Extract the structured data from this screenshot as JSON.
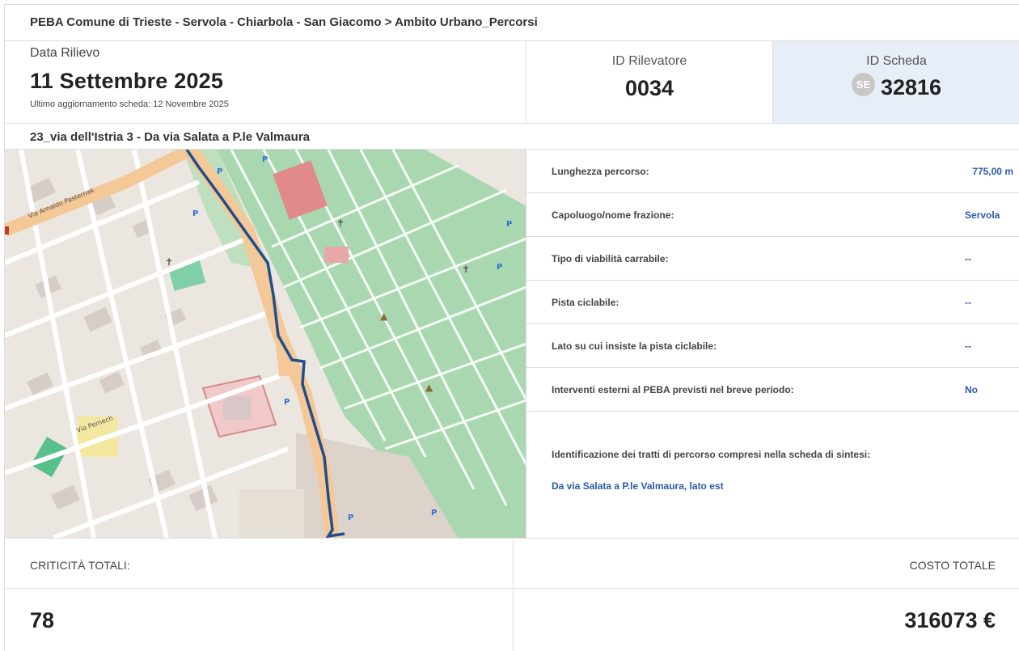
{
  "header": {
    "title": "PEBA Comune di Trieste - Servola - Chiarbola - San Giacomo > Ambito Urbano_Percorsi"
  },
  "survey": {
    "date_label": "Data Rilievo",
    "date_value": "11 Settembre 2025",
    "updated": "Ultimo aggiornamento scheda: 12 Novembre 2025",
    "rilevatore_label": "ID Rilevatore",
    "rilevatore_value": "0034",
    "scheda_label": "ID Scheda",
    "scheda_badge": "SE",
    "scheda_value": "32816"
  },
  "route": {
    "name": "23_via dell'Istria 3 - Da via Salata a P.le Valmaura"
  },
  "map": {
    "street_label": "Via Arnaldo Pasternak",
    "street_label_2": "Via Pernech"
  },
  "details": [
    {
      "label": "Lunghezza percorso:",
      "value": "775,00 m"
    },
    {
      "label": "Capoluogo/nome frazione:",
      "value": "Servola"
    },
    {
      "label": "Tipo di viabilità carrabile:",
      "value": "--"
    },
    {
      "label": "Pista ciclabile:",
      "value": "--"
    },
    {
      "label": "Lato su cui insiste la pista ciclabile:",
      "value": "--"
    },
    {
      "label": "Interventi esterni al PEBA previsti nel breve periodo:",
      "value": "No"
    }
  ],
  "identification": {
    "label": "Identificazione dei tratti di percorso compresi nella scheda di sintesi:",
    "value": "Da via Salata a P.le Valmaura, lato est"
  },
  "totals": {
    "criticita_label": "CRITICITÀ TOTALI:",
    "criticita_value": "78",
    "costo_label": "COSTO TOTALE",
    "costo_value": "316073 €"
  },
  "colors": {
    "route_line": "#1f4e8c",
    "link_text": "#2a5aa8",
    "scheda_bg": "#e8eef7",
    "cemetery_green": "#a9d8b0",
    "main_road": "#f4c897"
  }
}
